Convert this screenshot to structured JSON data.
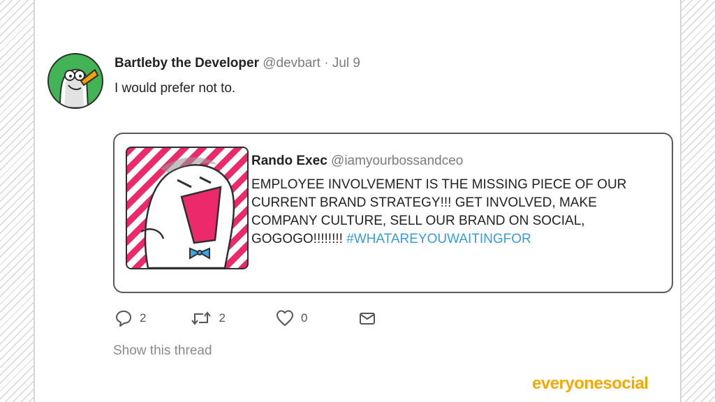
{
  "tweet": {
    "author_name": "Bartleby the Developer",
    "handle": "@devbart",
    "separator": "·",
    "date": "Jul 9",
    "text": "I would prefer not to.",
    "avatar_icon": "bartleby-bird-avatar-icon"
  },
  "quoted_tweet": {
    "author_name": "Rando Exec",
    "handle": "@iamyourbossandceo",
    "text": "EMPLOYEE INVOLVEMENT IS THE MISSING PIECE OF OUR CURRENT BRAND STRATEGY!!! GET INVOLVED, MAKE COMPANY CULTURE, SELL OUR BRAND ON SOCIAL, GOGOGO!!!!!!!! ",
    "hashtag": "#WHATAREYOUWAITINGFOR",
    "avatar_icon": "shouting-exec-avatar-icon"
  },
  "actions": {
    "reply": {
      "icon": "reply-icon",
      "count": "2"
    },
    "retweet": {
      "icon": "retweet-icon",
      "count": "2"
    },
    "like": {
      "icon": "heart-icon",
      "count": "0"
    },
    "message": {
      "icon": "envelope-icon"
    }
  },
  "show_thread": "Show this thread",
  "brand": {
    "logo_text": "everyonesocial",
    "color": "#f5a800"
  },
  "colors": {
    "hashtag": "#3a9bd5",
    "avatar_green": "#43b455",
    "exec_pink": "#ec2a6b",
    "bowtie_blue": "#3aa8e0"
  }
}
